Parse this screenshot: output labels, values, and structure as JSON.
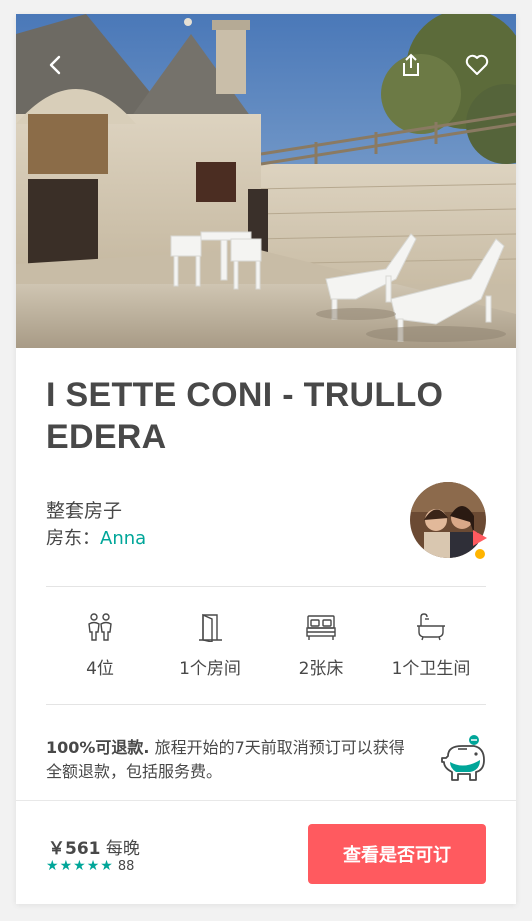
{
  "listing": {
    "title": "I SETTE CONI - TRULLO EDERA",
    "type": "整套房子",
    "host_prefix": "房东：",
    "host_name": "Anna"
  },
  "amenities": [
    {
      "icon": "guests-icon",
      "label": "4位"
    },
    {
      "icon": "door-icon",
      "label": "1个房间"
    },
    {
      "icon": "bed-icon",
      "label": "2张床"
    },
    {
      "icon": "bathtub-icon",
      "label": "1个卫生间"
    }
  ],
  "refund": {
    "bold": "100%可退款.",
    "text": " 旅程开始的7天前取消预订可以获得全额退款，包括服务费。"
  },
  "footer": {
    "price": "￥561",
    "per": "每晚",
    "rating_stars": 5,
    "review_count": "88",
    "cta_label": "查看是否可订"
  },
  "colors": {
    "accent": "#00a699",
    "cta": "#ff5a5f",
    "text": "#484848"
  }
}
